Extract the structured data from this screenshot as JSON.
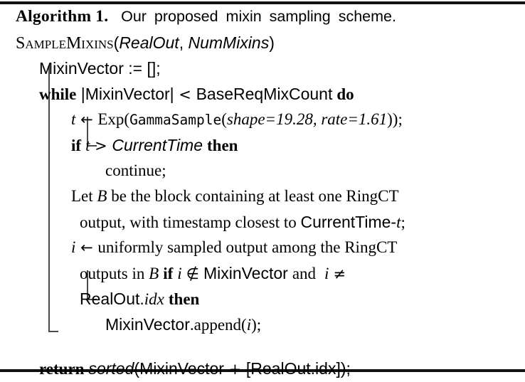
{
  "caption": {
    "label": "Algorithm 1.",
    "text": "Our proposed mixin sampling scheme."
  },
  "signature": {
    "name": "SampleMixins",
    "open_paren": "(",
    "arg1": "RealOut",
    "comma": ", ",
    "arg2": "NumMixins",
    "close_paren": ")"
  },
  "lines": {
    "init": {
      "var": "MixinVector",
      "assign": " := ",
      "value": "[];"
    },
    "while": {
      "kw": "while",
      "bar_open": " |",
      "var": "MixinVector",
      "bar_close": "|",
      "op": " < ",
      "bound": "BaseReqMixCount",
      "do": "do"
    },
    "sample": {
      "var": "t",
      "arrow": " ← ",
      "fn": "Exp(",
      "inner_fn": "GammaSample",
      "inner_open": "(",
      "param1_name": "shape=",
      "param1_value": "19.28",
      "param_sep": ", ",
      "param2_name": "rate=",
      "param2_value": "1.61",
      "close": "));"
    },
    "if_time": {
      "kw": "if",
      "var": "t",
      "op": " > ",
      "compare": "CurrentTime",
      "then": "then"
    },
    "continue": {
      "text": "continue;"
    },
    "let_block_1": {
      "pre": "Let ",
      "var": "B",
      "post": " be the block containing at least one RingCT"
    },
    "let_block_2": {
      "pre": "output, with timestamp closest to ",
      "ref": "CurrentTime-",
      "var": "t",
      "post": ";"
    },
    "pick_1": {
      "var": "i",
      "arrow": " ← ",
      "text": "uniformly sampled output among the RingCT"
    },
    "pick_2": {
      "pre": "outputs in ",
      "block": "B",
      "kw": "if",
      "var1": "i",
      "notin": "∉",
      "set": "MixinVector",
      "and": "and",
      "var2": "i",
      "neq": "≠"
    },
    "pick_3": {
      "ref": "RealOut.",
      "field": "idx",
      "then": "then"
    },
    "append": {
      "target": "MixinVector",
      "method": ".append(",
      "arg": "i",
      "close": ");"
    },
    "return": {
      "kw": "return",
      "fn": "sorted",
      "open": "(",
      "vec": "MixinVector",
      "plus": " + ",
      "bracket_open": "[",
      "real": "RealOut.idx",
      "bracket_close": "]",
      "close": ");"
    }
  },
  "colors": {
    "text": "#000000",
    "rule": "#111111",
    "block_rule": "#4a4a4a"
  }
}
